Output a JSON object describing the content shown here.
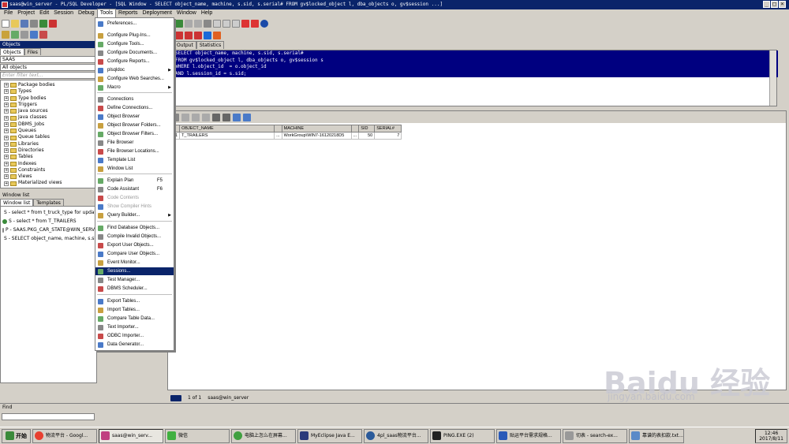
{
  "window": {
    "title": "saas@win_server - PL/SQL Developer - [SQL Window - SELECT object_name, machine, s.sid, s.serial# FROM gv$locked_object l, dba_objects o, gv$session ...]",
    "min": "_",
    "max": "□",
    "close": "×"
  },
  "menu": [
    "File",
    "Project",
    "Edit",
    "Session",
    "Debug",
    "Tools",
    "Reports",
    "Deployment",
    "Window",
    "Help"
  ],
  "left": {
    "objects_header": "Objects",
    "tabs": [
      "Objects",
      "Files"
    ],
    "schema": "SAAS",
    "filter": "All objects",
    "filter_placeholder": "Enter filter text...",
    "tree": [
      "Package bodies",
      "Types",
      "Type bodies",
      "Triggers",
      "Java sources",
      "Java classes",
      "DBMS_Jobs",
      "Queues",
      "Queue tables",
      "Libraries",
      "Directories",
      "Tables",
      "Indexes",
      "Constraints",
      "Views",
      "Materialized views"
    ],
    "windowlist_header": "Window list",
    "windowlist_tabs": [
      "Window list",
      "Templates"
    ],
    "windows": [
      "S - select * from t_truck_type for update",
      "S - select * from T_TRAILERS",
      "P - SAAS.PKG_CAR_STATE@WIN_SERVER",
      "S - SELECT object_name, machine, s.sid, s.serial#"
    ]
  },
  "tools_menu": {
    "items": [
      {
        "label": "Preferences...",
        "y": 0
      },
      {
        "label": "Configure Plug-Ins...",
        "y": 1
      },
      {
        "label": "Configure Tools...",
        "y": 2
      },
      {
        "label": "Configure Documents...",
        "y": 3
      },
      {
        "label": "Configure Reports...",
        "y": 4
      },
      {
        "label": "plsqldoc",
        "y": 5,
        "sub": true
      },
      {
        "label": "Configure Web Searches...",
        "y": 6
      },
      {
        "label": "Macro",
        "y": 7,
        "sub": true
      },
      {
        "label": "Connections",
        "y": 8
      },
      {
        "label": "Define Connections...",
        "y": 9
      },
      {
        "label": "Object Browser",
        "y": 10
      },
      {
        "label": "Object Browser Folders...",
        "y": 11
      },
      {
        "label": "Object Browser Filters...",
        "y": 12
      },
      {
        "label": "File Browser",
        "y": 13
      },
      {
        "label": "File Browser Locations...",
        "y": 14
      },
      {
        "label": "Template List",
        "y": 15
      },
      {
        "label": "Window List",
        "y": 16
      },
      {
        "label": "Explain Plan",
        "y": 17,
        "shortcut": "F5"
      },
      {
        "label": "Code Assistant",
        "y": 18,
        "shortcut": "F6"
      },
      {
        "label": "Code Contents",
        "y": 19,
        "disabled": true
      },
      {
        "label": "Show Compiler Hints",
        "y": 20,
        "disabled": true
      },
      {
        "label": "Query Builder...",
        "y": 21,
        "sub": true
      },
      {
        "label": "Find Database Objects...",
        "y": 22
      },
      {
        "label": "Compile Invalid Objects...",
        "y": 23
      },
      {
        "label": "Export User Objects...",
        "y": 24
      },
      {
        "label": "Compare User Objects...",
        "y": 25
      },
      {
        "label": "Event Monitor...",
        "y": 26
      },
      {
        "label": "Sessions...",
        "y": 27,
        "highlight": true
      },
      {
        "label": "Test Manager...",
        "y": 28
      },
      {
        "label": "DBMS Scheduler...",
        "y": 29
      },
      {
        "label": "Export Tables...",
        "y": 30
      },
      {
        "label": "Import Tables...",
        "y": 31
      },
      {
        "label": "Compare Table Data...",
        "y": 32
      },
      {
        "label": "Text Importer...",
        "y": 33
      },
      {
        "label": "ODBC Importer...",
        "y": 34
      },
      {
        "label": "Data Generator...",
        "y": 35
      }
    ]
  },
  "editor": {
    "tabs": [
      "Output",
      "Statistics"
    ],
    "sql_lines": [
      "SELECT object_name, machine, s.sid, s.serial#",
      "FROM gv$locked_object l, dba_objects o, gv$session s",
      "WHERE l.object_id  = o.object_id",
      "AND l.session_id = s.sid;"
    ]
  },
  "result": {
    "columns": [
      "",
      "OBJECT_NAME",
      "",
      "MACHINE",
      "",
      "SID",
      "SERIAL#"
    ],
    "rows": [
      [
        "1",
        "T_TRAILERS",
        "...",
        "WorkGroup\\WIN7-16120218D5",
        "...",
        "50",
        "7"
      ]
    ]
  },
  "status": {
    "record": "1 of 1",
    "connection": "saas@win_server"
  },
  "find": {
    "label": "Find"
  },
  "taskbar": {
    "start": "开始",
    "items": [
      "物流平台 - Googl...",
      "saas@win_serv...",
      "微信",
      "电脑上怎么在屏幕...",
      "MyEclipse Java E...",
      "4pl_saas物流平台...",
      "PING.EXE (2)",
      "贴运平台需求规格...",
      "切表 - search-ex...",
      "靠谱的表扣款.txt..."
    ],
    "time": "12:46",
    "date": "2017/8/11"
  },
  "watermark": {
    "logo": "Baidu 经验",
    "url": "jingyan.baidu.com"
  },
  "colors": {
    "titlebar": "#0a246a",
    "highlight": "#0a246a",
    "selection": "#000080"
  }
}
